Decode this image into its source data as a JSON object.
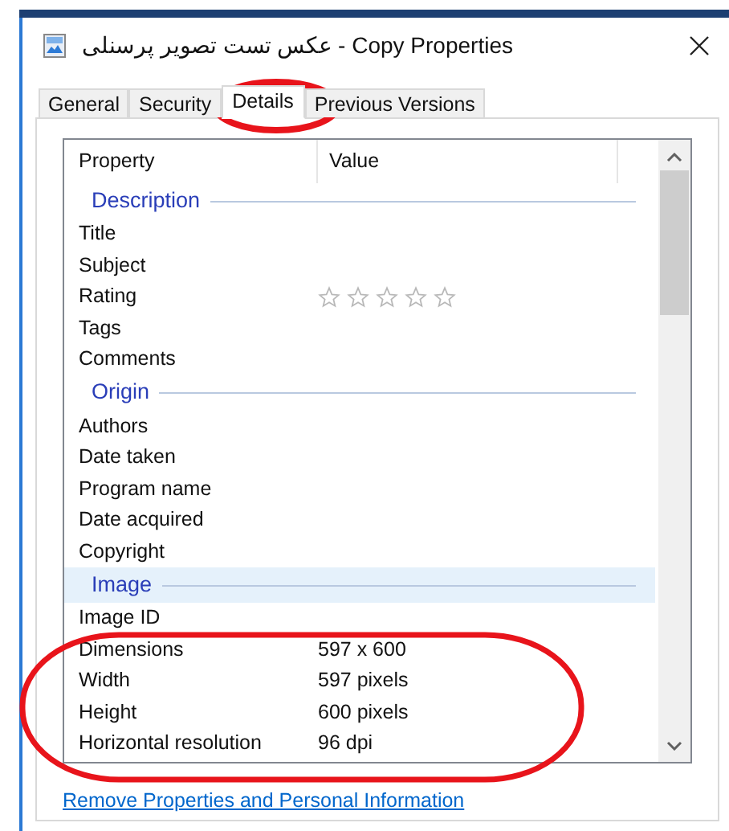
{
  "window": {
    "title": "عکس تست تصویر پرسنلی - Copy Properties"
  },
  "tabs": [
    {
      "label": "General",
      "selected": false
    },
    {
      "label": "Security",
      "selected": false
    },
    {
      "label": "Details",
      "selected": true
    },
    {
      "label": "Previous Versions",
      "selected": false
    }
  ],
  "details": {
    "columns": [
      "Property",
      "Value"
    ],
    "groups": [
      {
        "name": "Description",
        "selected": false,
        "rows": [
          {
            "kind": "text",
            "property": "Title"
          },
          {
            "kind": "text",
            "property": "Subject"
          },
          {
            "kind": "stars",
            "property": "Rating",
            "stars": 0
          },
          {
            "kind": "text",
            "property": "Tags"
          },
          {
            "kind": "text",
            "property": "Comments"
          }
        ]
      },
      {
        "name": "Origin",
        "selected": false,
        "rows": [
          {
            "kind": "text",
            "property": "Authors"
          },
          {
            "kind": "text",
            "property": "Date taken"
          },
          {
            "kind": "text",
            "property": "Program name"
          },
          {
            "kind": "text",
            "property": "Date acquired"
          },
          {
            "kind": "text",
            "property": "Copyright"
          }
        ]
      },
      {
        "name": "Image",
        "selected": true,
        "rows": [
          {
            "kind": "text",
            "property": "Image ID"
          },
          {
            "kind": "text",
            "property": "Dimensions",
            "value": "597 x 600"
          },
          {
            "kind": "text",
            "property": "Width",
            "value": "597 pixels"
          },
          {
            "kind": "text",
            "property": "Height",
            "value": "600 pixels"
          },
          {
            "kind": "text",
            "property": "Horizontal resolution",
            "value": "96 dpi"
          }
        ]
      }
    ]
  },
  "link": "Remove Properties and Personal Information"
}
